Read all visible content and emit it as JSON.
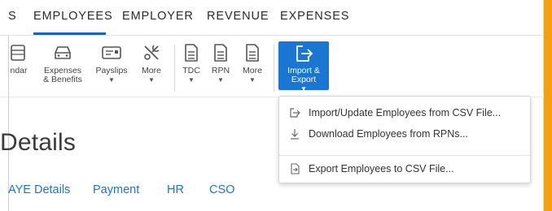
{
  "top_nav": {
    "tabs": [
      {
        "label": "S"
      },
      {
        "label": "EMPLOYEES"
      },
      {
        "label": "EMPLOYER"
      },
      {
        "label": "REVENUE"
      },
      {
        "label": "EXPENSES"
      }
    ],
    "active": "EMPLOYEES"
  },
  "ribbon": {
    "tools": [
      {
        "label": "ndar",
        "icon": "calendar-icon"
      },
      {
        "label": "Expenses\n& Benefits",
        "icon": "car-icon"
      },
      {
        "label": "Payslips",
        "icon": "payslip-card-icon",
        "caret": "▼"
      },
      {
        "label": "More",
        "icon": "tools-icon",
        "caret": "▼"
      },
      {
        "label": "TDC",
        "icon": "document-icon",
        "caret": "▼"
      },
      {
        "label": "RPN",
        "icon": "document-icon",
        "caret": "▼"
      },
      {
        "label": "More",
        "icon": "document-icon",
        "caret": "▼"
      },
      {
        "label": "Import &\nExport",
        "icon": "export-icon",
        "caret": "▼"
      }
    ]
  },
  "page": {
    "title": "Details",
    "subtabs": [
      {
        "label": "AYE Details"
      },
      {
        "label": "Payment"
      },
      {
        "label": "HR"
      },
      {
        "label": "CSO"
      }
    ]
  },
  "menu": {
    "items": [
      {
        "label": "Import/Update Employees from CSV File...",
        "icon": "import-icon"
      },
      {
        "label": "Download Employees from RPNs...",
        "icon": "download-icon"
      },
      {
        "label": "Export Employees to CSV File...",
        "icon": "export-file-icon"
      }
    ]
  },
  "colors": {
    "accent": "#1976d2",
    "link": "#1f73c8",
    "orange": "#f5a00f"
  }
}
